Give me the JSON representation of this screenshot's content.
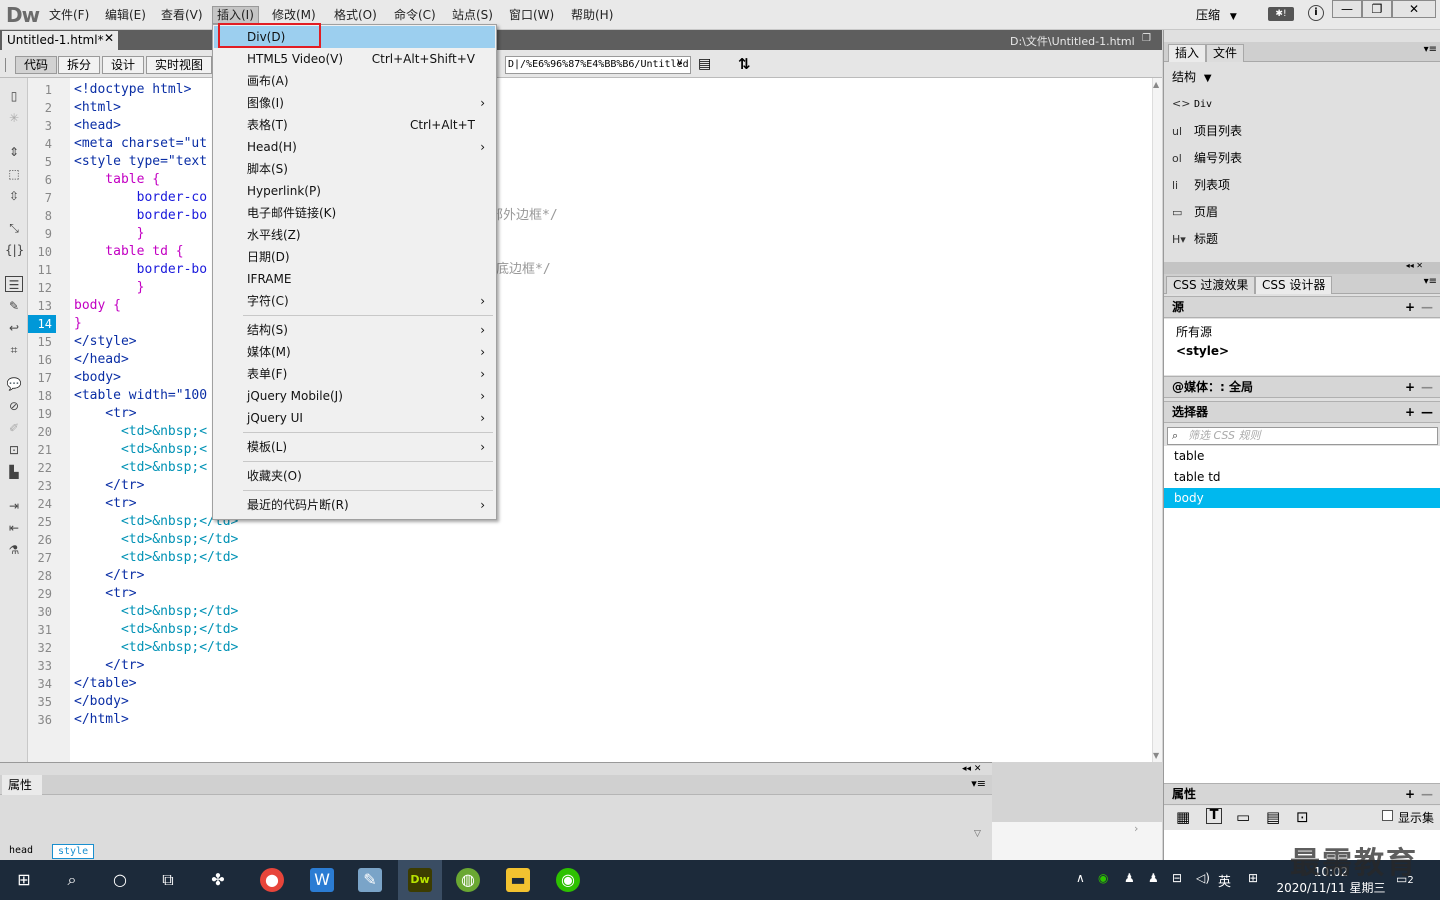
{
  "app": {
    "logo": "Dw",
    "menu": [
      "文件(F)",
      "编辑(E)",
      "查看(V)",
      "插入(I)",
      "修改(M)",
      "格式(O)",
      "命令(C)",
      "站点(S)",
      "窗口(W)",
      "帮助(H)"
    ],
    "compress_label": "压缩",
    "window_buttons": [
      "—",
      "❐",
      "✕"
    ]
  },
  "document": {
    "tab_name": "Untitled-1.html*",
    "path": "D:\\文件\\Untitled-1.html",
    "view_buttons": [
      "代码",
      "拆分",
      "设计",
      "实时视图"
    ],
    "address": "D|/%E6%96%87%E4%BB%B6/Untitled"
  },
  "code": {
    "current_line": 14,
    "line_numbers": [
      "1",
      "2",
      "3",
      "4",
      "5",
      "6",
      "7",
      "8",
      "9",
      "10",
      "11",
      "12",
      "13",
      "14",
      "15",
      "16",
      "17",
      "18",
      "19",
      "20",
      "21",
      "22",
      "23",
      "24",
      "25",
      "26",
      "27",
      "28",
      "29",
      "30",
      "31",
      "32",
      "33",
      "34",
      "35",
      "36"
    ],
    "lines": [
      "<!doctype html>",
      "<html>",
      "<head>",
      "<meta charset=\"ut",
      "<style type=\"text",
      "    table {",
      "        border-co",
      "        border-bo",
      "        }",
      "    table td {",
      "        border-bo",
      "        }",
      "body {",
      "}",
      "</style>",
      "</head>",
      "<body>",
      "<table width=\"100",
      "    <tr>",
      "      <td>&nbsp;<",
      "      <td>&nbsp;<",
      "      <td>&nbsp;<",
      "    </tr>",
      "    <tr>",
      "      <td>&nbsp;</td>",
      "      <td>&nbsp;</td>",
      "      <td>&nbsp;</td>",
      "    </tr>",
      "    <tr>",
      "      <td>&nbsp;</td>",
      "      <td>&nbsp;</td>",
      "      <td>&nbsp;</td>",
      "    </tr>",
      "</table>",
      "</body>",
      "</html>"
    ],
    "comment_line7": "部外边框*/",
    "comment_line10": "底边框*/"
  },
  "insert_menu": {
    "items": [
      {
        "label": "Div(D)",
        "shortcut": "",
        "submenu": false
      },
      {
        "label": "HTML5 Video(V)",
        "shortcut": "Ctrl+Alt+Shift+V",
        "submenu": false
      },
      {
        "label": "画布(A)",
        "shortcut": "",
        "submenu": false
      },
      {
        "label": "图像(I)",
        "shortcut": "",
        "submenu": true
      },
      {
        "label": "表格(T)",
        "shortcut": "Ctrl+Alt+T",
        "submenu": false
      },
      {
        "label": "Head(H)",
        "shortcut": "",
        "submenu": true
      },
      {
        "label": "脚本(S)",
        "shortcut": "",
        "submenu": false
      },
      {
        "label": "Hyperlink(P)",
        "shortcut": "",
        "submenu": false
      },
      {
        "label": "电子邮件链接(K)",
        "shortcut": "",
        "submenu": false
      },
      {
        "label": "水平线(Z)",
        "shortcut": "",
        "submenu": false
      },
      {
        "label": "日期(D)",
        "shortcut": "",
        "submenu": false
      },
      {
        "label": "IFRAME",
        "shortcut": "",
        "submenu": false
      },
      {
        "label": "字符(C)",
        "shortcut": "",
        "submenu": true
      },
      {
        "label": "结构(S)",
        "shortcut": "",
        "submenu": true
      },
      {
        "label": "媒体(M)",
        "shortcut": "",
        "submenu": true
      },
      {
        "label": "表单(F)",
        "shortcut": "",
        "submenu": true
      },
      {
        "label": "jQuery Mobile(J)",
        "shortcut": "",
        "submenu": true
      },
      {
        "label": "jQuery UI",
        "shortcut": "",
        "submenu": true
      },
      {
        "label": "模板(L)",
        "shortcut": "",
        "submenu": true
      },
      {
        "label": "收藏夹(O)",
        "shortcut": "",
        "submenu": false
      },
      {
        "label": "最近的代码片断(R)",
        "shortcut": "",
        "submenu": true
      }
    ]
  },
  "right_panel": {
    "top_tabs": [
      "插入",
      "文件"
    ],
    "structure_label": "结构",
    "insert_items": [
      {
        "icon": "<>",
        "label": "Div"
      },
      {
        "icon": "ul",
        "label": "项目列表"
      },
      {
        "icon": "ol",
        "label": "编号列表"
      },
      {
        "icon": "li",
        "label": "列表项"
      },
      {
        "icon": "▭",
        "label": "页眉"
      },
      {
        "icon": "H▾",
        "label": "标题"
      }
    ],
    "css_tabs": [
      "CSS 过渡效果",
      "CSS 设计器"
    ],
    "source_head": "源",
    "sources": [
      "所有源",
      "<style>"
    ],
    "media_head": "@媒体：: 全局",
    "selector_head": "选择器",
    "filter_placeholder": "筛选 CSS 规则",
    "selectors": [
      "table",
      "table td",
      "body"
    ],
    "active_selector": "body",
    "props_head": "属性",
    "show_set_label": "显示集"
  },
  "properties_panel": {
    "tab": "属性"
  },
  "status": {
    "tags": [
      "head",
      "style"
    ]
  },
  "taskbar": {
    "time": "10:02",
    "date": "2020/11/11 星期三",
    "ime": "英",
    "notif_count": "2"
  },
  "watermark": "最需教育"
}
